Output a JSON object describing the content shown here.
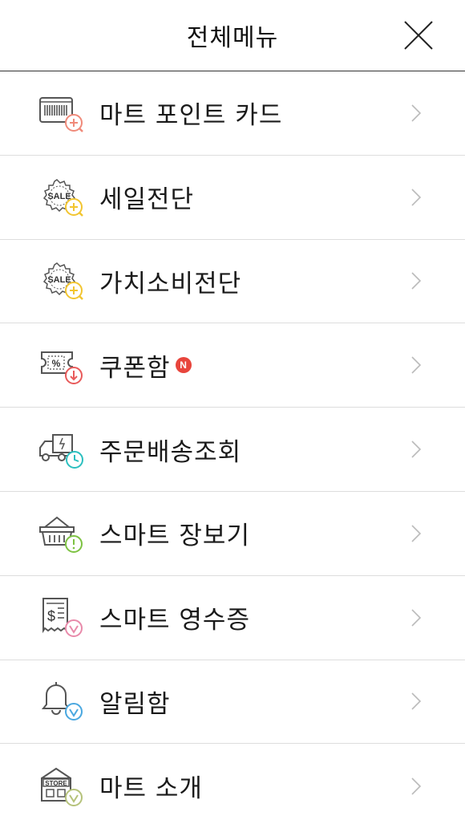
{
  "header": {
    "title": "전체메뉴",
    "close_icon": "close-icon"
  },
  "colors": {
    "badge": "#e8453c",
    "divider": "#dddddd",
    "header_border": "#333333",
    "chevron": "#bbbbbb",
    "icon_gray": "#555555"
  },
  "menu": {
    "items": [
      {
        "label": "마트 포인트 카드",
        "icon": "barcode-card-icon",
        "accent": "#f08a7a"
      },
      {
        "label": "세일전단",
        "icon": "sale-badge-icon",
        "accent": "#f2c530"
      },
      {
        "label": "가치소비전단",
        "icon": "sale-badge-icon",
        "accent": "#f2c530"
      },
      {
        "label": "쿠폰함",
        "icon": "coupon-icon",
        "accent": "#e85a5a",
        "badge": "N"
      },
      {
        "label": "주문배송조회",
        "icon": "delivery-truck-icon",
        "accent": "#2bbfbf"
      },
      {
        "label": "스마트 장보기",
        "icon": "shopping-basket-icon",
        "accent": "#7dc242"
      },
      {
        "label": "스마트 영수증",
        "icon": "receipt-icon",
        "accent": "#e88aaa"
      },
      {
        "label": "알림함",
        "icon": "bell-icon",
        "accent": "#4aa8e0"
      },
      {
        "label": "마트 소개",
        "icon": "store-icon",
        "accent": "#b5c27a"
      }
    ]
  }
}
